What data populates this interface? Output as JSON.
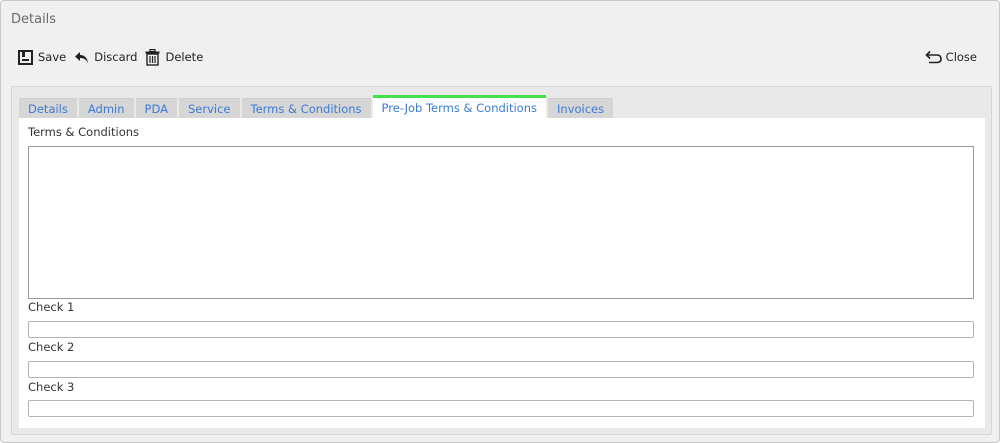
{
  "window": {
    "title": "Details"
  },
  "toolbar": {
    "save_label": "Save",
    "discard_label": "Discard",
    "delete_label": "Delete",
    "close_label": "Close"
  },
  "tabs": [
    {
      "label": "Details",
      "active": false
    },
    {
      "label": "Admin",
      "active": false
    },
    {
      "label": "PDA",
      "active": false
    },
    {
      "label": "Service",
      "active": false
    },
    {
      "label": "Terms & Conditions",
      "active": false
    },
    {
      "label": "Pre-Job Terms & Conditions",
      "active": true
    },
    {
      "label": "Invoices",
      "active": false
    }
  ],
  "form": {
    "terms_label": "Terms & Conditions",
    "terms_value": "",
    "check1_label": "Check 1",
    "check1_value": "",
    "check2_label": "Check 2",
    "check2_value": "",
    "check3_label": "Check 3",
    "check3_value": ""
  },
  "colors": {
    "active_tab_accent": "#44e24a",
    "tab_text": "#3a7bd5"
  },
  "icons": {
    "save": "save-icon",
    "discard": "undo-arrow-icon",
    "delete": "trash-icon",
    "close": "return-arrow-icon"
  }
}
